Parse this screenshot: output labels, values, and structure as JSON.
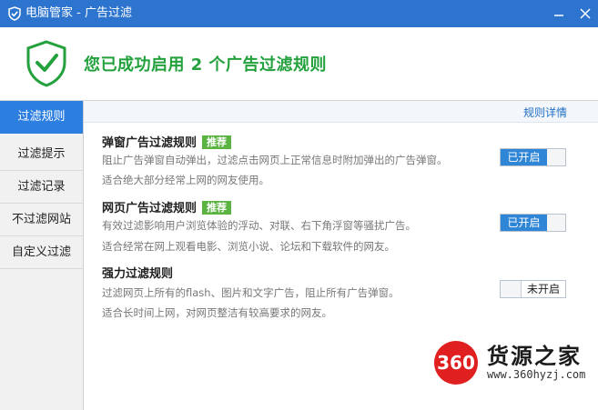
{
  "window": {
    "title": "电脑管家 - 广告过滤",
    "minimize_icon": "minimize-icon",
    "close_icon": "close-icon",
    "accent": "#2d74cf"
  },
  "banner": {
    "icon": "shield-check-icon",
    "message": "您已成功启用 2 个广告过滤规则",
    "color": "#23a13d"
  },
  "sidebar": {
    "items": [
      {
        "label": "过滤规则",
        "active": true
      },
      {
        "label": "过滤提示",
        "active": false
      },
      {
        "label": "过滤记录",
        "active": false
      },
      {
        "label": "不过滤网站",
        "active": false
      },
      {
        "label": "自定义过滤",
        "active": false
      }
    ]
  },
  "main": {
    "details_link": "规则详情",
    "rules": [
      {
        "title": "弹窗广告过滤规则",
        "badge": "推荐",
        "desc1": "阻止广告弹窗自动弹出，过滤点击网页上正常信息时附加弹出的广告弹窗。",
        "desc2": "适合绝大部分经常上网的网友使用。",
        "toggle": "已开启",
        "enabled": true
      },
      {
        "title": "网页广告过滤规则",
        "badge": "推荐",
        "desc1": "有效过滤影响用户浏览体验的浮动、对联、右下角浮窗等骚扰广告。",
        "desc2": "适合经常在网上观看电影、浏览小说、论坛和下载软件的网友。",
        "toggle": "已开启",
        "enabled": true
      },
      {
        "title": "强力过滤规则",
        "desc1": "过滤网页上所有的flash、图片和文字广告，阻止所有广告弹窗。",
        "desc2": "适合长时间上网，对网页整洁有较高要求的网友。",
        "toggle": "未开启",
        "enabled": false
      }
    ]
  },
  "watermark": {
    "logo_text": "360",
    "brand": "货源之家",
    "url": "www.360hyzj.com"
  }
}
